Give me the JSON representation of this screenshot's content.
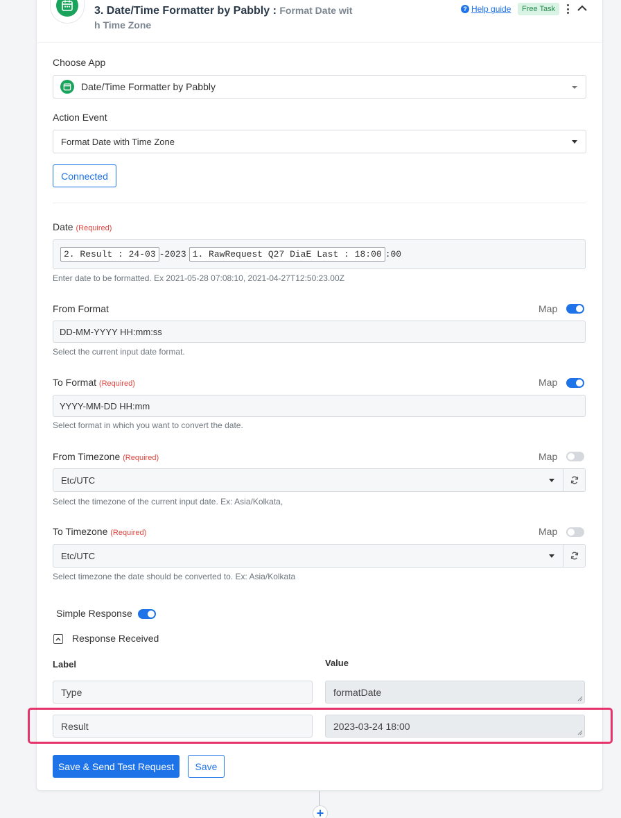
{
  "header": {
    "title": "3. Date/Time Formatter by Pabbly :",
    "subtitle_line1": "Format Date wit",
    "subtitle_line2": "h Time Zone",
    "help_label": "Help guide",
    "badge": "Free Task",
    "icon": "calendar-icon"
  },
  "choose_app": {
    "label": "Choose App",
    "value": "Date/Time Formatter by Pabbly"
  },
  "action_event": {
    "label": "Action Event",
    "value": "Format Date with Time Zone"
  },
  "connected_label": "Connected",
  "required_text": "(Required)",
  "map_label": "Map",
  "date": {
    "label": "Date",
    "tag1": "2. Result : 24-03",
    "text1": "-2023",
    "tag2": "1. RawRequest Q27 DiaE Last : 18:00",
    "text2": ":00",
    "hint": "Enter date to be formatted. Ex 2021-05-28 07:08:10, 2021-04-27T12:50:23.00Z"
  },
  "from_format": {
    "label": "From Format",
    "value": "DD-MM-YYYY HH:mm:ss",
    "hint": "Select the current input date format.",
    "map_on": true
  },
  "to_format": {
    "label": "To Format",
    "value": "YYYY-MM-DD HH:mm",
    "hint": "Select format in which you want to convert the date.",
    "map_on": true
  },
  "from_timezone": {
    "label": "From Timezone",
    "value": "Etc/UTC",
    "hint": "Select the timezone of the current input date. Ex: Asia/Kolkata,",
    "map_on": false
  },
  "to_timezone": {
    "label": "To Timezone",
    "value": "Etc/UTC",
    "hint": "Select timezone the date should be converted to. Ex: Asia/Kolkata",
    "map_on": false
  },
  "simple_response": {
    "label": "Simple Response",
    "on": true
  },
  "response_received": {
    "label": "Response Received",
    "col_label": "Label",
    "col_value": "Value",
    "rows": [
      {
        "label": "Type",
        "value": "formatDate"
      },
      {
        "label": "Result",
        "value": "2023-03-24 18:00"
      }
    ]
  },
  "buttons": {
    "save_test": "Save & Send Test Request",
    "save": "Save"
  },
  "colors": {
    "primary": "#1e73e8",
    "app_green": "#1aa35b",
    "required_red": "#e0443e",
    "highlight": "#e6336b"
  }
}
